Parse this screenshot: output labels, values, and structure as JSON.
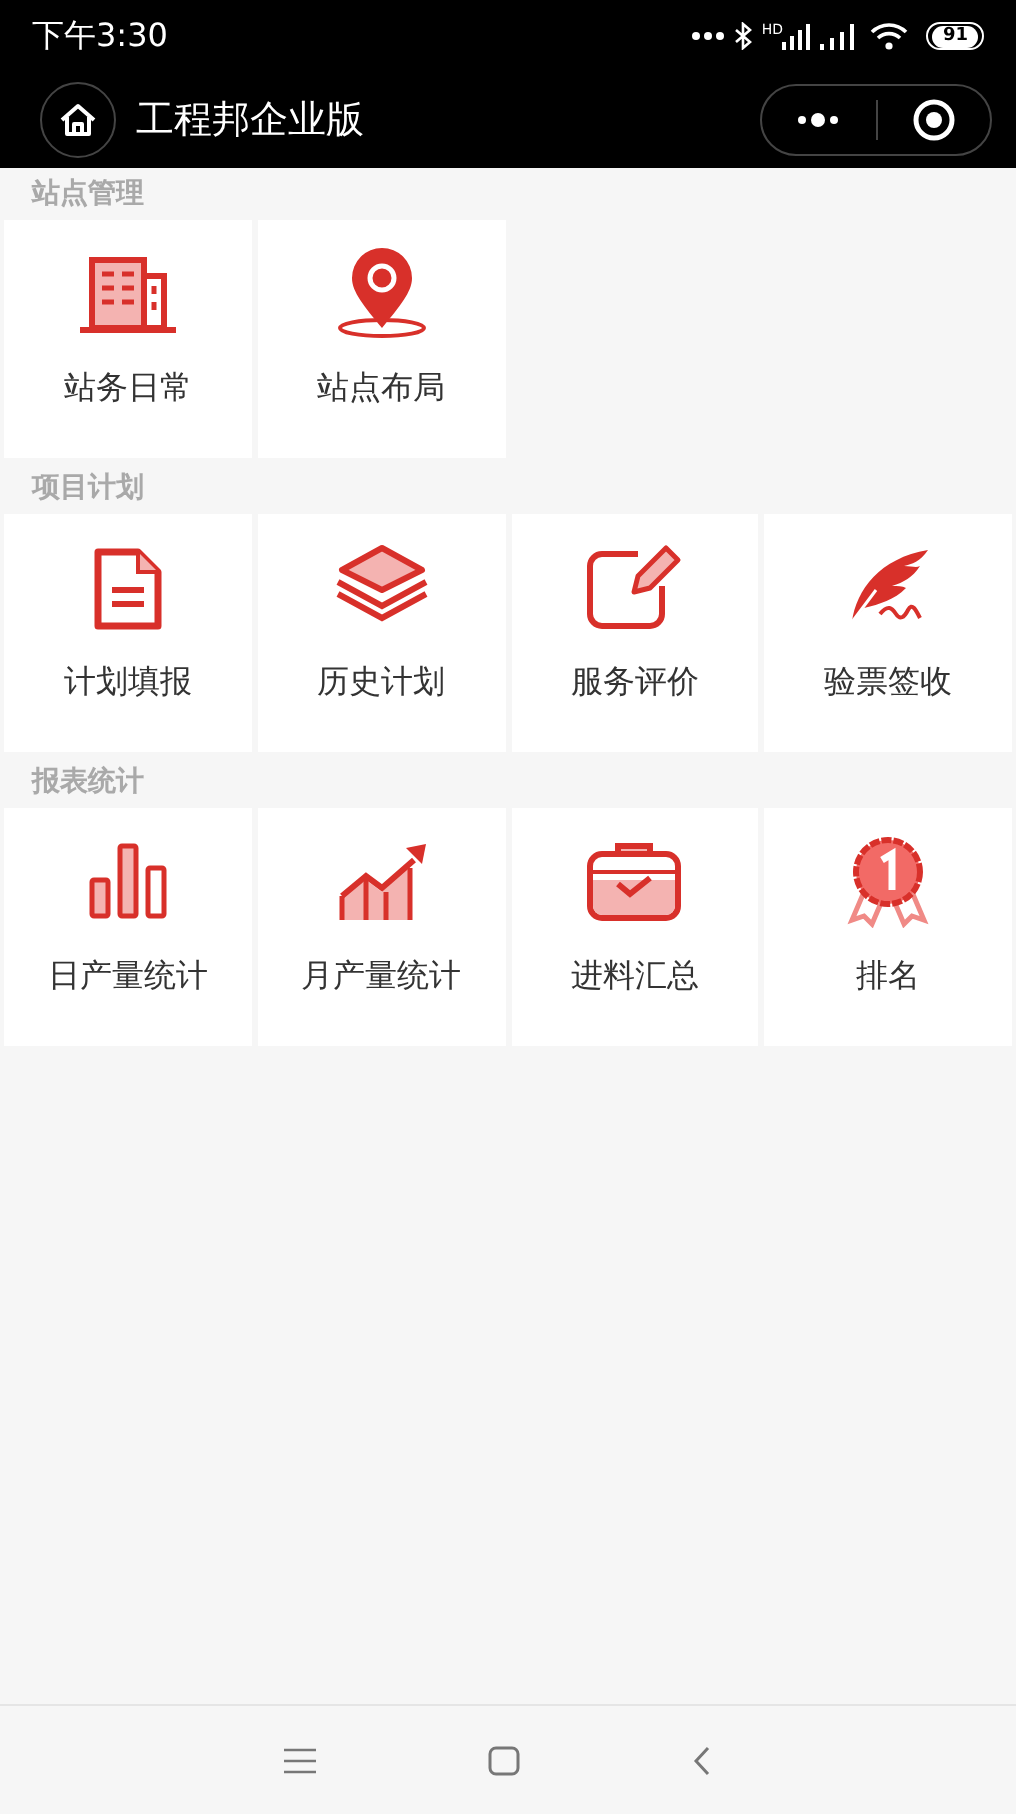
{
  "status_bar": {
    "time": "下午3:30",
    "network_label": "HD",
    "battery": "91"
  },
  "nav_bar": {
    "title": "工程邦企业版"
  },
  "sections": [
    {
      "title": "站点管理",
      "items": [
        {
          "label": "站务日常"
        },
        {
          "label": "站点布局"
        }
      ]
    },
    {
      "title": "项目计划",
      "items": [
        {
          "label": "计划填报"
        },
        {
          "label": "历史计划"
        },
        {
          "label": "服务评价"
        },
        {
          "label": "验票签收"
        }
      ]
    },
    {
      "title": "报表统计",
      "items": [
        {
          "label": "日产量统计"
        },
        {
          "label": "月产量统计"
        },
        {
          "label": "进料汇总"
        },
        {
          "label": "排名"
        }
      ]
    }
  ]
}
